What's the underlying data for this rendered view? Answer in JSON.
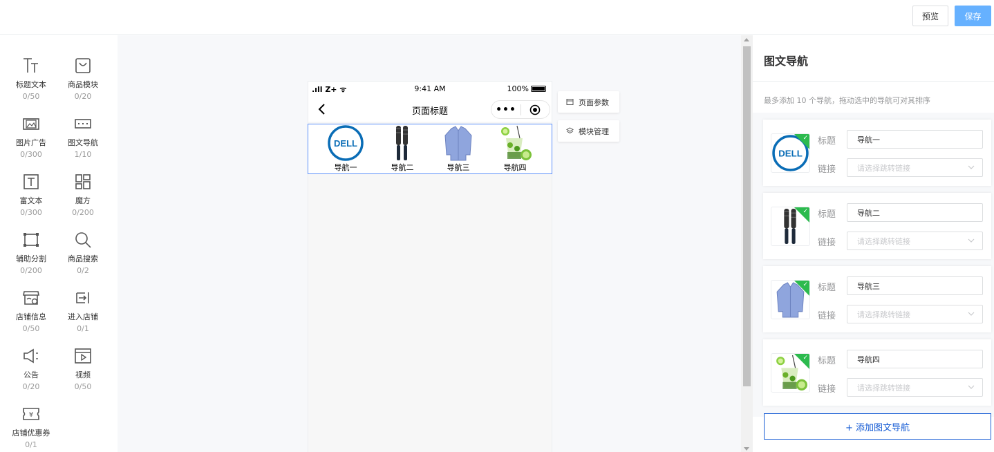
{
  "header": {
    "preview_label": "预览",
    "save_label": "保存"
  },
  "components": [
    {
      "name": "标题文本",
      "count": "0/50",
      "icon": "title-text-icon"
    },
    {
      "name": "商品模块",
      "count": "0/20",
      "icon": "shopping-bag-icon"
    },
    {
      "name": "图片广告",
      "count": "0/300",
      "icon": "image-ad-icon"
    },
    {
      "name": "图文导航",
      "count": "1/10",
      "icon": "image-nav-icon"
    },
    {
      "name": "富文本",
      "count": "0/300",
      "icon": "rich-text-icon"
    },
    {
      "name": "魔方",
      "count": "0/200",
      "icon": "cube-layout-icon"
    },
    {
      "name": "辅助分割",
      "count": "0/200",
      "icon": "divider-icon"
    },
    {
      "name": "商品搜索",
      "count": "0/2",
      "icon": "search-icon"
    },
    {
      "name": "店铺信息",
      "count": "0/50",
      "icon": "store-info-icon"
    },
    {
      "name": "进入店铺",
      "count": "0/1",
      "icon": "enter-store-icon"
    },
    {
      "name": "公告",
      "count": "0/20",
      "icon": "announcement-icon"
    },
    {
      "name": "视频",
      "count": "0/50",
      "icon": "video-icon"
    },
    {
      "name": "店铺优惠券",
      "count": "0/1",
      "icon": "coupon-icon"
    }
  ],
  "phone": {
    "carrier": "Z+",
    "time": "9:41 AM",
    "battery": "100%",
    "page_title": "页面标题",
    "more_dots": "•••",
    "nav_items": [
      {
        "label": "导航一",
        "image": "dell-logo"
      },
      {
        "label": "导航二",
        "image": "hair-brush"
      },
      {
        "label": "导航三",
        "image": "blue-shirt"
      },
      {
        "label": "导航四",
        "image": "lime-cocktail"
      }
    ]
  },
  "side_tabs": [
    {
      "label": "页面参数",
      "icon": "page-settings-icon"
    },
    {
      "label": "模块管理",
      "icon": "layers-icon"
    }
  ],
  "settings": {
    "title": "图文导航",
    "description": "最多添加 10 个导航，拖动选中的导航可对其排序",
    "title_label": "标题",
    "link_label": "链接",
    "link_placeholder": "请选择跳转链接",
    "items": [
      {
        "title_value": "导航一",
        "image": "dell-logo"
      },
      {
        "title_value": "导航二",
        "image": "hair-brush"
      },
      {
        "title_value": "导航三",
        "image": "blue-shirt"
      },
      {
        "title_value": "导航四",
        "image": "lime-cocktail"
      }
    ],
    "add_button": "+ 添加图文导航"
  },
  "colors": {
    "accent": "#155bd4",
    "save": "#66b1ff",
    "selected_border": "#5b8ff9",
    "check": "#2cba4e"
  }
}
